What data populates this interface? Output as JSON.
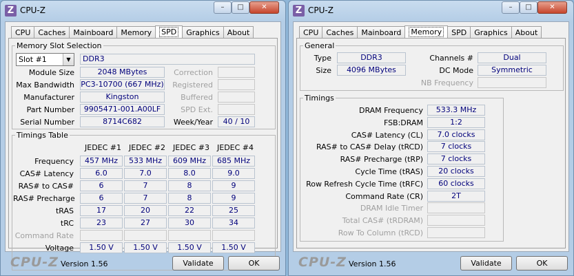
{
  "left": {
    "title": "CPU-Z",
    "app_icon": "Z",
    "titlebar_buttons": {
      "minimize": "–",
      "maximize": "□",
      "close": "✕"
    },
    "tabs": [
      "CPU",
      "Caches",
      "Mainboard",
      "Memory",
      "SPD",
      "Graphics",
      "About"
    ],
    "active_tab": "SPD",
    "slot_group": {
      "legend": "Memory Slot Selection",
      "slot_selected": "Slot #1",
      "type": "DDR3",
      "module_size_label": "Module Size",
      "module_size": "2048 MBytes",
      "max_bw_label": "Max Bandwidth",
      "max_bw": "PC3-10700 (667 MHz)",
      "manufacturer_label": "Manufacturer",
      "manufacturer": "Kingston",
      "part_label": "Part Number",
      "part": "9905471-001.A00LF",
      "serial_label": "Serial Number",
      "serial": "8714C682",
      "correction_label": "Correction",
      "registered_label": "Registered",
      "buffered_label": "Buffered",
      "spd_ext_label": "SPD Ext.",
      "week_year_label": "Week/Year",
      "week_year": "40 / 10"
    },
    "timings_group": {
      "legend": "Timings Table",
      "columns": [
        "JEDEC #1",
        "JEDEC #2",
        "JEDEC #3",
        "JEDEC #4"
      ],
      "rows": [
        {
          "label": "Frequency",
          "values": [
            "457 MHz",
            "533 MHz",
            "609 MHz",
            "685 MHz"
          ]
        },
        {
          "label": "CAS# Latency",
          "values": [
            "6.0",
            "7.0",
            "8.0",
            "9.0"
          ]
        },
        {
          "label": "RAS# to CAS#",
          "values": [
            "6",
            "7",
            "8",
            "9"
          ]
        },
        {
          "label": "RAS# Precharge",
          "values": [
            "6",
            "7",
            "8",
            "9"
          ]
        },
        {
          "label": "tRAS",
          "values": [
            "17",
            "20",
            "22",
            "25"
          ]
        },
        {
          "label": "tRC",
          "values": [
            "23",
            "27",
            "30",
            "34"
          ]
        },
        {
          "label": "Command Rate",
          "values": [
            "",
            "",
            "",
            ""
          ]
        },
        {
          "label": "Voltage",
          "values": [
            "1.50 V",
            "1.50 V",
            "1.50 V",
            "1.50 V"
          ]
        }
      ]
    },
    "footer": {
      "logo": "CPU-Z",
      "version": "Version 1.56",
      "validate": "Validate",
      "ok": "OK"
    }
  },
  "right": {
    "title": "CPU-Z",
    "app_icon": "Z",
    "titlebar_buttons": {
      "minimize": "–",
      "maximize": "□",
      "close": "✕"
    },
    "tabs": [
      "CPU",
      "Caches",
      "Mainboard",
      "Memory",
      "SPD",
      "Graphics",
      "About"
    ],
    "active_tab": "Memory",
    "general": {
      "legend": "General",
      "type_label": "Type",
      "type": "DDR3",
      "size_label": "Size",
      "size": "4096 MBytes",
      "channels_label": "Channels #",
      "channels": "Dual",
      "dc_mode_label": "DC Mode",
      "dc_mode": "Symmetric",
      "nb_freq_label": "NB Frequency",
      "nb_freq": ""
    },
    "timings": {
      "legend": "Timings",
      "rows": [
        {
          "label": "DRAM Frequency",
          "value": "533.3 MHz",
          "dim": false
        },
        {
          "label": "FSB:DRAM",
          "value": "1:2",
          "dim": false
        },
        {
          "label": "CAS# Latency (CL)",
          "value": "7.0 clocks",
          "dim": false
        },
        {
          "label": "RAS# to CAS# Delay (tRCD)",
          "value": "7 clocks",
          "dim": false
        },
        {
          "label": "RAS# Precharge (tRP)",
          "value": "7 clocks",
          "dim": false
        },
        {
          "label": "Cycle Time (tRAS)",
          "value": "20 clocks",
          "dim": false
        },
        {
          "label": "Row Refresh Cycle Time (tRFC)",
          "value": "60 clocks",
          "dim": false
        },
        {
          "label": "Command Rate (CR)",
          "value": "2T",
          "dim": false
        },
        {
          "label": "DRAM Idle Timer",
          "value": "",
          "dim": true
        },
        {
          "label": "Total CAS# (tRDRAM)",
          "value": "",
          "dim": true
        },
        {
          "label": "Row To Column (tRCD)",
          "value": "",
          "dim": true
        }
      ]
    },
    "footer": {
      "logo": "CPU-Z",
      "version": "Version 1.56",
      "validate": "Validate",
      "ok": "OK"
    }
  }
}
